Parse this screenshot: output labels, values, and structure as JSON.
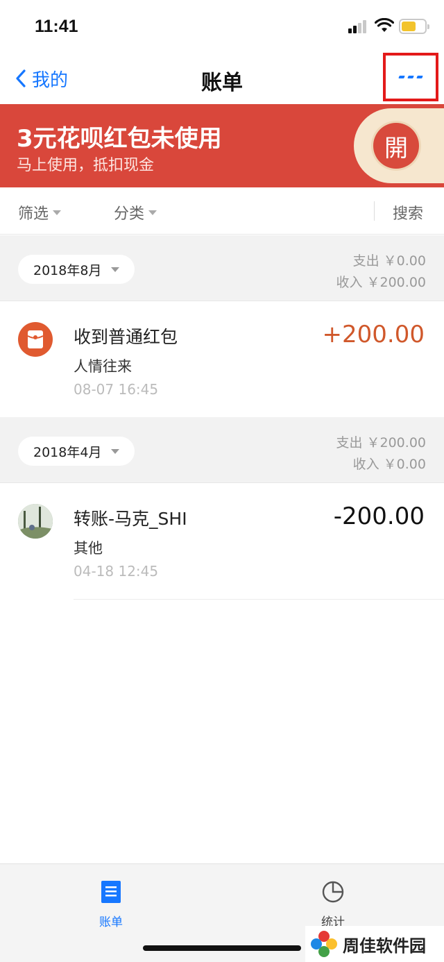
{
  "status_bar": {
    "time": "11:41"
  },
  "nav": {
    "back_label": "我的",
    "title": "账单"
  },
  "banner": {
    "title": "3元花呗红包未使用",
    "subtitle": "马上使用，抵扣现金",
    "open_label": "開"
  },
  "filters": {
    "filter_label": "筛选",
    "category_label": "分类",
    "search_label": "搜索"
  },
  "months": [
    {
      "label": "2018年8月",
      "expense": "支出 ￥0.00",
      "income": "收入 ￥200.00",
      "transactions": [
        {
          "title": "收到普通红包",
          "category": "人情往来",
          "time": "08-07 16:45",
          "amount": "+200.00",
          "amount_color": "#d0582b"
        }
      ]
    },
    {
      "label": "2018年4月",
      "expense": "支出 ￥200.00",
      "income": "收入 ￥0.00",
      "transactions": [
        {
          "title": "转账-马克_SHI",
          "category": "其他",
          "time": "04-18 12:45",
          "amount": "-200.00",
          "amount_color": "#111111"
        }
      ]
    }
  ],
  "tabs": [
    {
      "label": "账单",
      "icon": "bill-icon",
      "active": true
    },
    {
      "label": "统计",
      "icon": "pie-chart-icon",
      "active": false
    }
  ],
  "colors": {
    "accent": "#1677ff",
    "banner": "#d9473b",
    "income": "#d0582b",
    "highlight_box": "#e31a1a"
  },
  "watermark": {
    "text": "周佳软件园"
  }
}
